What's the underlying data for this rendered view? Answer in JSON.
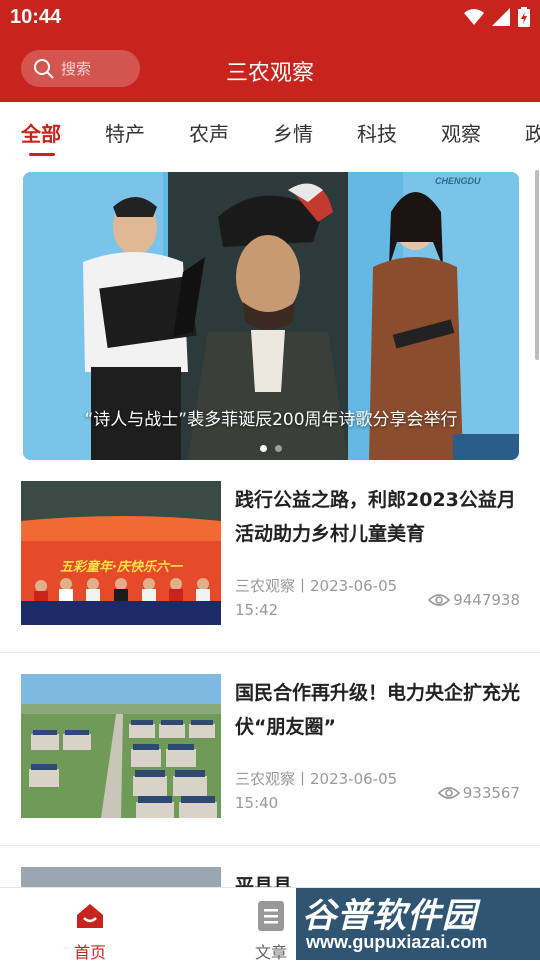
{
  "status_bar": {
    "time": "10:44"
  },
  "header": {
    "search_placeholder": "搜索",
    "title": "三农观察"
  },
  "tabs": [
    "全部",
    "特产",
    "农声",
    "乡情",
    "科技",
    "观察",
    "政"
  ],
  "banner": {
    "caption": "“诗人与战士”裴多菲诞辰200周年诗歌分享会举行",
    "stage_logo": "CHENGDU"
  },
  "news": [
    {
      "title": "践行公益之路，利郎2023公益月活动助力乡村儿童美育",
      "source": "三农观察丨2023-06-05 15:42",
      "views": "9447938",
      "thumb_text": "五彩童年·庆快乐六一"
    },
    {
      "title": "国民合作再升级！电力央企扩充光伏“朋友圈”",
      "source": "三农观察丨2023-06-05 15:40",
      "views": "933567"
    },
    {
      "title": "平县县"
    }
  ],
  "bottom_nav": [
    {
      "label": "首页"
    },
    {
      "label": "文章"
    }
  ],
  "watermark": {
    "title": "谷普软件园",
    "url": "www.gupuxiazai.com"
  },
  "colors": {
    "brand": "#c8241e",
    "watermark_bg": "#2f5573"
  }
}
